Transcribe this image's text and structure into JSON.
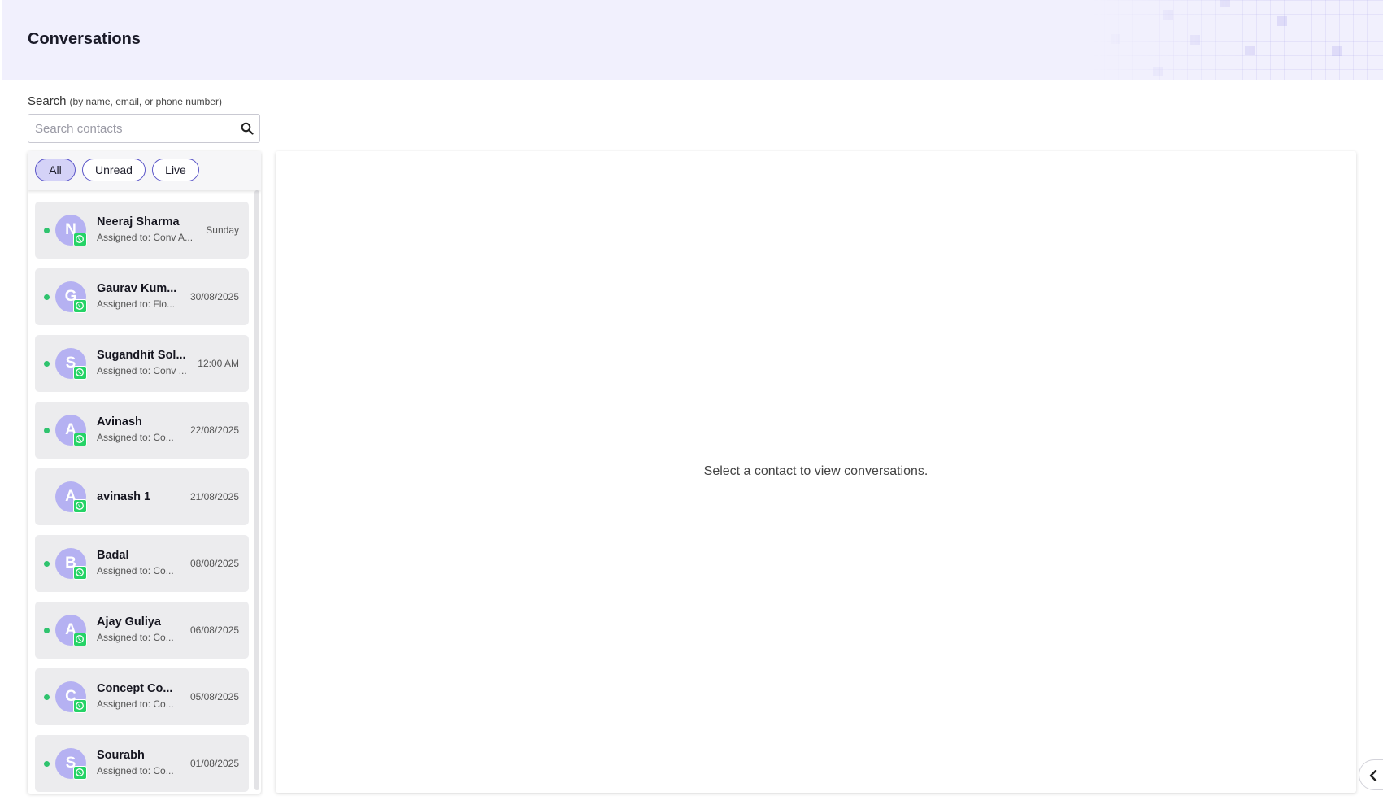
{
  "header": {
    "title": "Conversations"
  },
  "search": {
    "label": "Search",
    "hint": "(by name, email, or phone number)",
    "placeholder": "Search contacts"
  },
  "filters": [
    {
      "label": "All",
      "active": true
    },
    {
      "label": "Unread",
      "active": false
    },
    {
      "label": "Live",
      "active": false
    }
  ],
  "contacts": [
    {
      "initial": "N",
      "name": "Neeraj Sharma",
      "assigned": "Assigned to: Conv A...",
      "date": "Sunday",
      "online": true,
      "channel": "whatsapp-icon"
    },
    {
      "initial": "G",
      "name": "Gaurav Kum...",
      "assigned": "Assigned to: Flo...",
      "date": "30/08/2025",
      "online": true,
      "channel": "whatsapp-icon"
    },
    {
      "initial": "S",
      "name": "Sugandhit Sol...",
      "assigned": "Assigned to: Conv ...",
      "date": "12:00 AM",
      "online": true,
      "channel": "whatsapp-icon"
    },
    {
      "initial": "A",
      "name": "Avinash",
      "assigned": "Assigned to: Co...",
      "date": "22/08/2025",
      "online": true,
      "channel": "whatsapp-icon"
    },
    {
      "initial": "A",
      "name": "avinash 1",
      "assigned": "",
      "date": "21/08/2025",
      "online": false,
      "channel": "whatsapp-icon"
    },
    {
      "initial": "B",
      "name": "Badal",
      "assigned": "Assigned to: Co...",
      "date": "08/08/2025",
      "online": true,
      "channel": "whatsapp-icon"
    },
    {
      "initial": "A",
      "name": "Ajay Guliya",
      "assigned": "Assigned to: Co...",
      "date": "06/08/2025",
      "online": true,
      "channel": "whatsapp-icon"
    },
    {
      "initial": "C",
      "name": "Concept Co...",
      "assigned": "Assigned to: Co...",
      "date": "05/08/2025",
      "online": true,
      "channel": "whatsapp-icon"
    },
    {
      "initial": "S",
      "name": "Sourabh",
      "assigned": "Assigned to: Co...",
      "date": "01/08/2025",
      "online": true,
      "channel": "whatsapp-icon"
    }
  ],
  "conversation": {
    "empty_message": "Select a contact to view conversations."
  },
  "colors": {
    "accent": "#5a55c8",
    "avatar": "#b5b1f2",
    "online": "#2fc36e",
    "whatsapp": "#25d366",
    "header_bg": "#f1f0fd"
  }
}
